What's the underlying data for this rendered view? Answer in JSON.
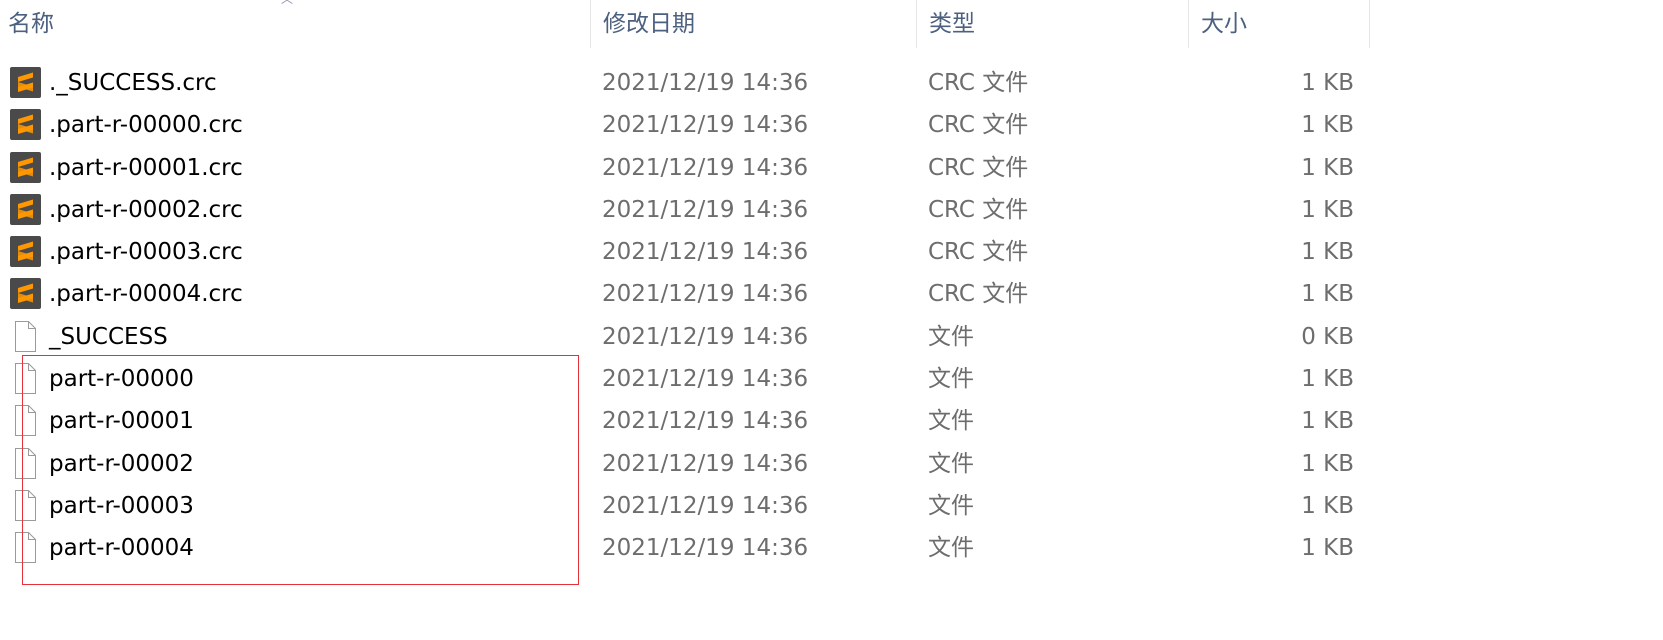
{
  "columns": {
    "name": "名称",
    "date": "修改日期",
    "type": "类型",
    "size": "大小"
  },
  "files": [
    {
      "name": "._SUCCESS.crc",
      "date": "2021/12/19 14:36",
      "type": "CRC 文件",
      "size": "1 KB",
      "icon": "sublime-text-icon"
    },
    {
      "name": ".part-r-00000.crc",
      "date": "2021/12/19 14:36",
      "type": "CRC 文件",
      "size": "1 KB",
      "icon": "sublime-text-icon"
    },
    {
      "name": ".part-r-00001.crc",
      "date": "2021/12/19 14:36",
      "type": "CRC 文件",
      "size": "1 KB",
      "icon": "sublime-text-icon"
    },
    {
      "name": ".part-r-00002.crc",
      "date": "2021/12/19 14:36",
      "type": "CRC 文件",
      "size": "1 KB",
      "icon": "sublime-text-icon"
    },
    {
      "name": ".part-r-00003.crc",
      "date": "2021/12/19 14:36",
      "type": "CRC 文件",
      "size": "1 KB",
      "icon": "sublime-text-icon"
    },
    {
      "name": ".part-r-00004.crc",
      "date": "2021/12/19 14:36",
      "type": "CRC 文件",
      "size": "1 KB",
      "icon": "sublime-text-icon"
    },
    {
      "name": "_SUCCESS",
      "date": "2021/12/19 14:36",
      "type": "文件",
      "size": "0 KB",
      "icon": "blank-file-icon"
    },
    {
      "name": "part-r-00000",
      "date": "2021/12/19 14:36",
      "type": "文件",
      "size": "1 KB",
      "icon": "blank-file-icon"
    },
    {
      "name": "part-r-00001",
      "date": "2021/12/19 14:36",
      "type": "文件",
      "size": "1 KB",
      "icon": "blank-file-icon"
    },
    {
      "name": "part-r-00002",
      "date": "2021/12/19 14:36",
      "type": "文件",
      "size": "1 KB",
      "icon": "blank-file-icon"
    },
    {
      "name": "part-r-00003",
      "date": "2021/12/19 14:36",
      "type": "文件",
      "size": "1 KB",
      "icon": "blank-file-icon"
    },
    {
      "name": "part-r-00004",
      "date": "2021/12/19 14:36",
      "type": "文件",
      "size": "1 KB",
      "icon": "blank-file-icon"
    }
  ],
  "colors": {
    "header_text": "#4c607f",
    "secondary_text": "#6d6d6d",
    "sublime_bg": "#4a4a4a",
    "sublime_accent": "#ff9800",
    "highlight_border": "#e5323a"
  }
}
